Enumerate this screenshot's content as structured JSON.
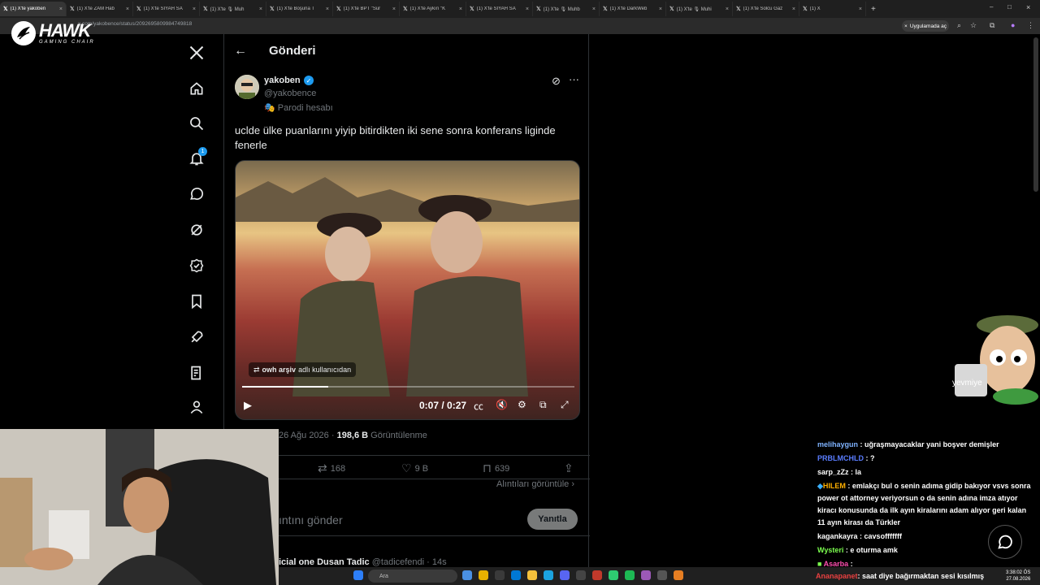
{
  "browser": {
    "tabs": [
      {
        "title": "(1) X'te yakoben",
        "active": true
      },
      {
        "title": "(1) X'te ZAM Hab"
      },
      {
        "title": "(1) X'te SİYAH SA"
      },
      {
        "title": "(1) X'te 🎙 Muh"
      },
      {
        "title": "(1) X'te Boşuna T"
      },
      {
        "title": "(1) X'te BPT \"Sur"
      },
      {
        "title": "(1) X'te Aykırı \"K"
      },
      {
        "title": "(1) X'te SİYAH SA"
      },
      {
        "title": "(1) X'te 🎙 Muhb"
      },
      {
        "title": "(1) X'te DarkWeb"
      },
      {
        "title": "(1) X'te 🎙 Muhi"
      },
      {
        "title": "(1) X'te Solcu Gaz"
      },
      {
        "title": "(1) X"
      }
    ],
    "url": "x.com/yakobence/status/2092695809984749818",
    "open_app_label": "Uygulamada aç"
  },
  "overlay": {
    "brand": "HAWK",
    "brand_sub": "GAMING CHAIR",
    "mascot_label": "yevmiye",
    "bottom_notice_user": "Ananapanet",
    "bottom_notice_text": ": saat diye bağırmaktan sesi kısılmış"
  },
  "nav": {
    "notification_count": "1"
  },
  "post": {
    "page_title": "Gönderi",
    "author_name": "yakoben",
    "author_handle": "@yakobence",
    "parody_label": "Parodi hesabı",
    "text": "uclde ülke puanlarını yiyip bitirdikten iki sene sonra konferans liginde fenerle",
    "video": {
      "caption_user": "owh arşiv",
      "caption_suffix": "adlı kullanıcıdan",
      "time": "0:07 / 0:27",
      "progress": 0.26
    },
    "date": "26 Ağu 2026",
    "views_count": "198,6 B",
    "views_label": "Görüntülenme",
    "reposts": "168",
    "likes": "9 B",
    "bookmarks": "639",
    "quotes_link": "Alıntıları görüntüle",
    "reply_placeholder": "ıntını gönder",
    "reply_button": "Yanıtla",
    "next_reply_name": "icial one Dusan Tadic",
    "next_reply_meta": "@tadicefendi · 14s"
  },
  "chat": [
    {
      "user": "melihaygun",
      "color": "#7fb3ff",
      "text": " : uğraşmayacaklar yani boşver demişler"
    },
    {
      "user": "PRBLMCHLD",
      "color": "#5a7dff",
      "text": " : ?"
    },
    {
      "user": "sarp_zZz",
      "color": "#ffffff",
      "text": " : la"
    },
    {
      "user": "HILEM",
      "color": "#ffb000",
      "text": " : emlakçı bul o senin adıma gidip bakıyor vsvs sonra power ot attorney veriyorsun o da senin adına imza atıyor kiracı konusunda da ilk ayın kiralarını adam alıyor geri kalan 11 ayın kirası da Türkler"
    },
    {
      "user": "kagankayra",
      "color": "#ffffff",
      "text": " : cavsofffffff"
    },
    {
      "user": "Wysteri",
      "color": "#7cff4f",
      "text": " : e oturma amk"
    },
    {
      "user": "Asarba",
      "color": "#ff4fb0",
      "text": " : "
    }
  ],
  "taskbar": {
    "search_label": "Ara",
    "time": "3:38:02 ÖS",
    "date": "27.08.2026"
  },
  "colors": {
    "accent": "#1d9bf0",
    "background": "#000000",
    "border": "#2f3336",
    "muted_text": "#71767b"
  }
}
